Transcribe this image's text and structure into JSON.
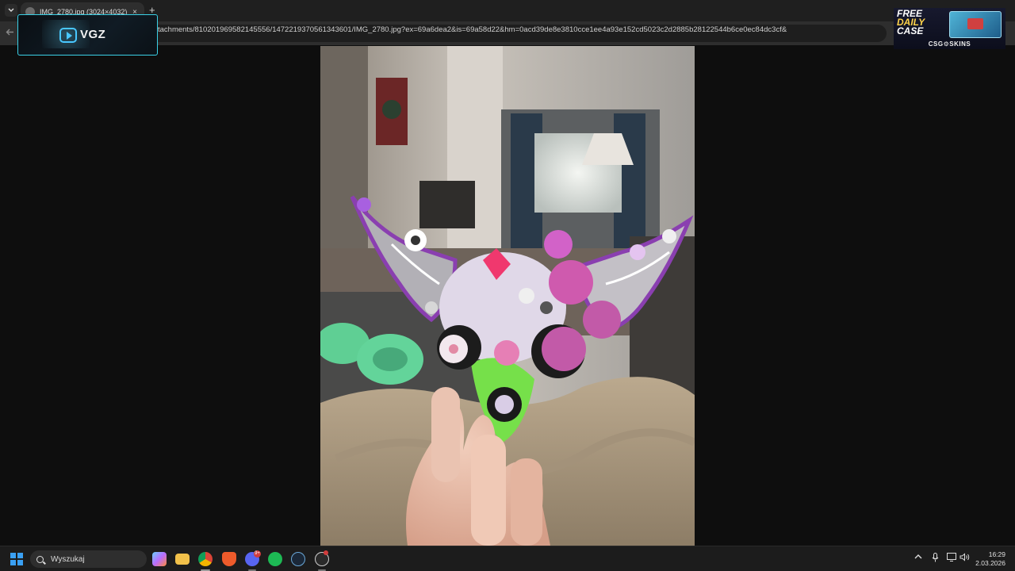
{
  "browser": {
    "tab_title": "IMG_2780.jpg (3024×4032)",
    "new_tab_label": "+",
    "close_tab_label": "×",
    "url": "tachments/810201969582145556/1472219370561343601/IMG_2780.jpg?ex=69a6dea2&is=69a58d22&hm=0acd39de8e3810cce1ee4a93e152cd5023c2d2885b28122544b6ce0ec84dc3cf&"
  },
  "overlay": {
    "logo_text": "VGZ"
  },
  "ad": {
    "line1": "FREE",
    "line2": "DAILY",
    "line3": "CASE",
    "brand": "CSG⚙SKINS"
  },
  "taskbar": {
    "search_placeholder": "Wyszukaj",
    "discord_badge": "9+",
    "time": "16:29",
    "date": "2.03.2026"
  },
  "colors": {
    "accent": "#3ad0e6",
    "windows_blue": "#3aa0f3"
  }
}
